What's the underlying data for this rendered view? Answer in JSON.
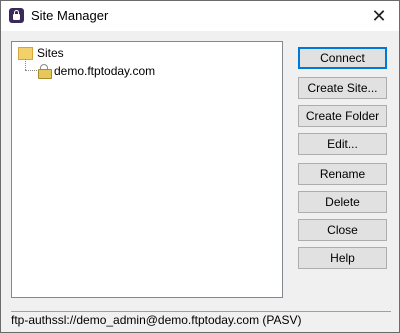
{
  "window": {
    "title": "Site Manager",
    "close_label": "✕"
  },
  "tree": {
    "root_label": "Sites",
    "site_label": "demo.ftptoday.com"
  },
  "buttons": {
    "connect": "Connect",
    "create_site": "Create Site...",
    "create_folder": "Create Folder",
    "edit": "Edit...",
    "rename": "Rename",
    "delete": "Delete",
    "close": "Close",
    "help": "Help"
  },
  "status": {
    "text": "ftp-authssl://demo_admin@demo.ftptoday.com (PASV)"
  },
  "colors": {
    "accent": "#0078d7",
    "app_icon": "#3b2a59",
    "folder": "#f2d06b"
  },
  "icons": {
    "app": "lock-icon",
    "folder": "folder-icon",
    "site": "padlock-icon",
    "close": "close-icon"
  }
}
